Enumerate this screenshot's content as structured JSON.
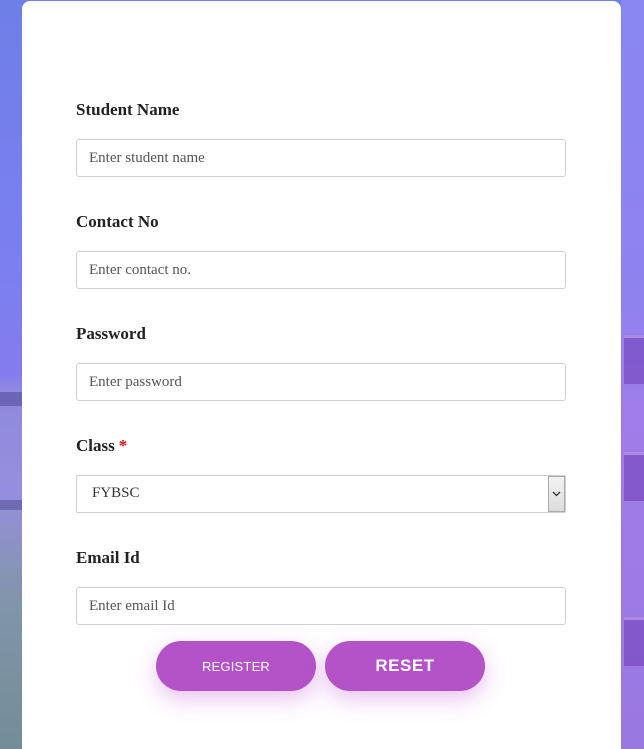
{
  "form": {
    "student_name": {
      "label": "Student Name",
      "placeholder": "Enter student name",
      "value": ""
    },
    "contact_no": {
      "label": "Contact No",
      "placeholder": "Enter contact no.",
      "value": ""
    },
    "password": {
      "label": "Password",
      "placeholder": "Enter password",
      "value": ""
    },
    "class": {
      "label": "Class",
      "required_mark": "*",
      "selected": "FYBSC"
    },
    "email": {
      "label": "Email Id",
      "placeholder": "Enter email Id",
      "value": ""
    }
  },
  "buttons": {
    "register_label": "REGISTER",
    "reset_label": "RESET"
  },
  "colors": {
    "accent": "#b452c7",
    "required": "#dd1111",
    "background": "#7b7ff0"
  },
  "icons": {
    "select_arrow": "chevron-down-icon"
  }
}
